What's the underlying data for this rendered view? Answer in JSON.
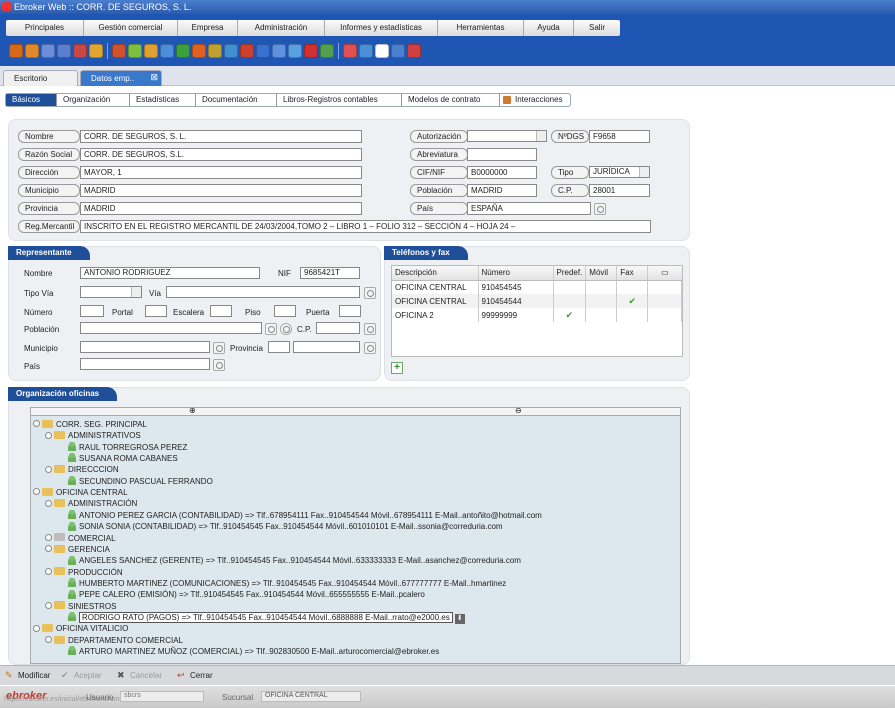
{
  "window": {
    "title": "Ebroker Web :: CORR. DE SEGUROS, S. L."
  },
  "menu": [
    "Principales",
    "Gestión comercial",
    "Empresa",
    "Administración",
    "Informes y estadísticas",
    "Herramientas",
    "Ayuda",
    "Salir"
  ],
  "toolbar_colors": [
    "#d66a1a",
    "#e08a2a",
    "#6a8ed8",
    "#5b7fd0",
    "#c84848",
    "#e0a830",
    "#d05030",
    "#7fbf3f",
    "#e0a030",
    "#4a8fd8",
    "#3aa040",
    "#e06020",
    "#c0a030",
    "#4090d0",
    "#d04030",
    "#3a70d0",
    "#6090e0",
    "#58a0e0",
    "#d03030",
    "#50a050",
    "#e05050",
    "#4a90d8",
    "#ffffff",
    "#4a80d0",
    "#d04040"
  ],
  "tabs": {
    "escritorio": "Escritorio",
    "datos": "Datos emp.."
  },
  "subtabs": [
    "Básicos",
    "Organización",
    "Estadísticas",
    "Documentación",
    "Libros-Registros contables",
    "Modelos de contrato",
    "Interacciones"
  ],
  "empresa": {
    "nombre_label": "Nombre",
    "nombre": "CORR. DE SEGUROS, S. L.",
    "razon_label": "Razón Social",
    "razon": "CORR. DE SEGUROS, S.L.",
    "direccion_label": "Dirección",
    "direccion": "MAYOR, 1",
    "municipio_label": "Municipio",
    "municipio": "MADRID",
    "provincia_label": "Provincia",
    "provincia": "MADRID",
    "regmerc_label": "Reg.Mercantil",
    "regmerc": "INSCRITO EN EL REGISTRO MERCANTIL DE 24/03/2004,TOMO 2 – LIBRO 1 – FOLIO 312 – SECCIÓN 4 – HOJA 24 –",
    "autorizacion_label": "Autorización",
    "autorizacion": "",
    "ndgs_label": "NºDGS",
    "ndgs": "F9658",
    "abreviatura_label": "Abreviatura",
    "abreviatura": "",
    "cif_label": "CIF/NIF",
    "cif": "B0000000",
    "tipo_label": "Tipo",
    "tipo": "JURÍDICA",
    "poblacion_label": "Población",
    "poblacion": "MADRID",
    "cp_label": "C.P.",
    "cp": "28001",
    "pais_label": "País",
    "pais": "ESPAÑA"
  },
  "representante": {
    "title": "Representante",
    "nombre_label": "Nombre",
    "nombre": "ANTONIO RODRIGUEZ",
    "nif_label": "NIF",
    "nif": "9685421T",
    "tipovia_label": "Tipo Vía",
    "via_label": "Vía",
    "numero_label": "Número",
    "portal_label": "Portal",
    "escalera_label": "Escalera",
    "piso_label": "Piso",
    "puerta_label": "Puerta",
    "poblacion_label": "Población",
    "cp_label": "C.P.",
    "municipio_label": "Municipio",
    "provincia_label": "Provincia",
    "pais_label": "País"
  },
  "telefonos": {
    "title": "Teléfonos y fax",
    "columns": [
      "Descripción",
      "Número",
      "Predef.",
      "Móvil",
      "Fax"
    ],
    "rows": [
      {
        "desc": "OFICINA CENTRAL",
        "num": "910454545",
        "predef": "",
        "movil": "",
        "fax": ""
      },
      {
        "desc": "OFICINA CENTRAL",
        "num": "910454544",
        "predef": "",
        "movil": "",
        "fax": "✔"
      },
      {
        "desc": "OFICINA 2",
        "num": "99999999",
        "predef": "✔",
        "movil": "",
        "fax": ""
      }
    ]
  },
  "organizacion": {
    "title": "Organización oficinas",
    "nodes": [
      {
        "level": 0,
        "type": "folder",
        "text": "CORR. SEG. PRINCIPAL"
      },
      {
        "level": 1,
        "type": "folder",
        "text": "ADMINISTRATIVOS"
      },
      {
        "level": 2,
        "type": "person",
        "text": "RAUL TORREGROSA PEREZ"
      },
      {
        "level": 2,
        "type": "person",
        "text": "SUSANA ROMA CABANES"
      },
      {
        "level": 1,
        "type": "folder",
        "text": "DIRECCCION"
      },
      {
        "level": 2,
        "type": "person",
        "text": "SECUNDINO PASCUAL FERRANDO"
      },
      {
        "level": 0,
        "type": "folder",
        "text": "OFICINA CENTRAL"
      },
      {
        "level": 1,
        "type": "folder",
        "text": "ADMINISTRACIÓN"
      },
      {
        "level": 2,
        "type": "person",
        "text": "ANTONIO PEREZ GARCIA (CONTABILIDAD) => Tlf..678954111 Fax..910454544 Móvil..678954111 E-Mail..antoñito@hotmail.com"
      },
      {
        "level": 2,
        "type": "person",
        "text": "SONIA SONIA (CONTABILIDAD) => Tlf..910454545 Fax..910454544 Móvil..601010101 E-Mail..ssonia@correduria.com"
      },
      {
        "level": 1,
        "type": "grey",
        "text": "COMERCIAL"
      },
      {
        "level": 1,
        "type": "folder",
        "text": "GERENCIA"
      },
      {
        "level": 2,
        "type": "person",
        "text": "ANGELES SANCHEZ (GERENTE) => Tlf..910454545 Fax..910454544 Móvil..633333333 E-Mail..asanchez@correduria.com"
      },
      {
        "level": 1,
        "type": "folder",
        "text": "PRODUCCIÓN"
      },
      {
        "level": 2,
        "type": "person",
        "text": "HUMBERTO MARTINEZ (COMUNICACIONES) => Tlf..910454545 Fax..910454544 Móvil..677777777 E-Mail..hmartinez"
      },
      {
        "level": 2,
        "type": "person",
        "text": "PEPE CALERO (EMISIÓN) => Tlf..910454545 Fax..910454544 Móvil..655555555 E-Mail..pcalero"
      },
      {
        "level": 1,
        "type": "folder",
        "text": "SINIESTROS"
      },
      {
        "level": 2,
        "type": "person",
        "text": "RODRIGO RATO (PAGOS) => Tlf..910454545 Fax..910454544 Móvil..6888888 E-Mail..rrato@e2000.es",
        "selected": true
      },
      {
        "level": 0,
        "type": "folder",
        "text": "OFICINA VITALICIO"
      },
      {
        "level": 1,
        "type": "folder",
        "text": "DEPARTAMENTO COMERCIAL"
      },
      {
        "level": 2,
        "type": "person",
        "text": "ARTURO MARTINEZ MUÑOZ (COMERCIAL) => Tlf..902830500 E-Mail..arturocomercial@ebroker.es"
      }
    ]
  },
  "bottom": {
    "modificar": "Modificar",
    "aceptar": "Aceptar",
    "cancelar": "Cancelar",
    "cerrar": "Cerrar"
  },
  "status": {
    "logo": "ebroker",
    "url": "https://ebroker.es/inicial/ebroker.shtml#",
    "usuario_label": "Usuario",
    "usuario": "sbcrs",
    "sucursal_label": "Sucursal",
    "sucursal": "OFICINA CENTRAL"
  }
}
